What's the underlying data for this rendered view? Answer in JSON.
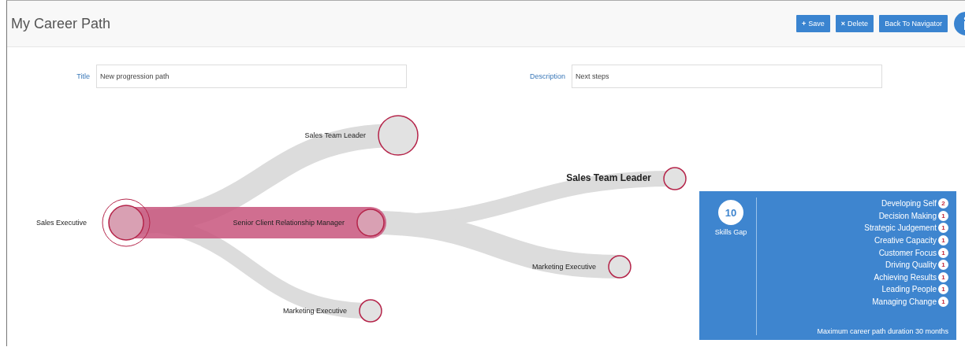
{
  "header": {
    "title": "My Career Path",
    "buttons": [
      {
        "icon": "+",
        "label": "Save"
      },
      {
        "icon": "×",
        "label": "Delete"
      },
      {
        "label": "Back To Navigator"
      }
    ]
  },
  "form": {
    "fields": [
      {
        "label": "Title",
        "value": "New progression path"
      },
      {
        "label": "Description",
        "value": "Next steps"
      }
    ]
  },
  "path": {
    "label": "Sales Executive",
    "selected": true,
    "emphasized": false,
    "children": [
      {
        "label": "Sales Team Leader",
        "selected": false,
        "emphasized": false
      },
      {
        "label": "Senior Client Relationship Manager",
        "selected": true,
        "emphasized": false,
        "children": [
          {
            "label": "Sales Team Leader",
            "selected": false,
            "emphasized": true
          },
          {
            "label": "Marketing Executive",
            "selected": false,
            "emphasized": false
          }
        ]
      },
      {
        "label": "Marketing Executive",
        "selected": false,
        "emphasized": false
      }
    ]
  },
  "skills_panel": {
    "total": "10",
    "total_label": "Skills Gap",
    "skills": [
      {
        "name": "Developing Self",
        "count": "2"
      },
      {
        "name": "Decision Making",
        "count": "1"
      },
      {
        "name": "Strategic Judgement",
        "count": "1"
      },
      {
        "name": "Creative Capacity",
        "count": "1"
      },
      {
        "name": "Customer Focus",
        "count": "1"
      },
      {
        "name": "Driving Quality",
        "count": "1"
      },
      {
        "name": "Achieving Results",
        "count": "1"
      },
      {
        "name": "Leading People",
        "count": "1"
      },
      {
        "name": "Managing Change",
        "count": "1"
      }
    ],
    "footer": "Maximum career path duration 30 months"
  }
}
